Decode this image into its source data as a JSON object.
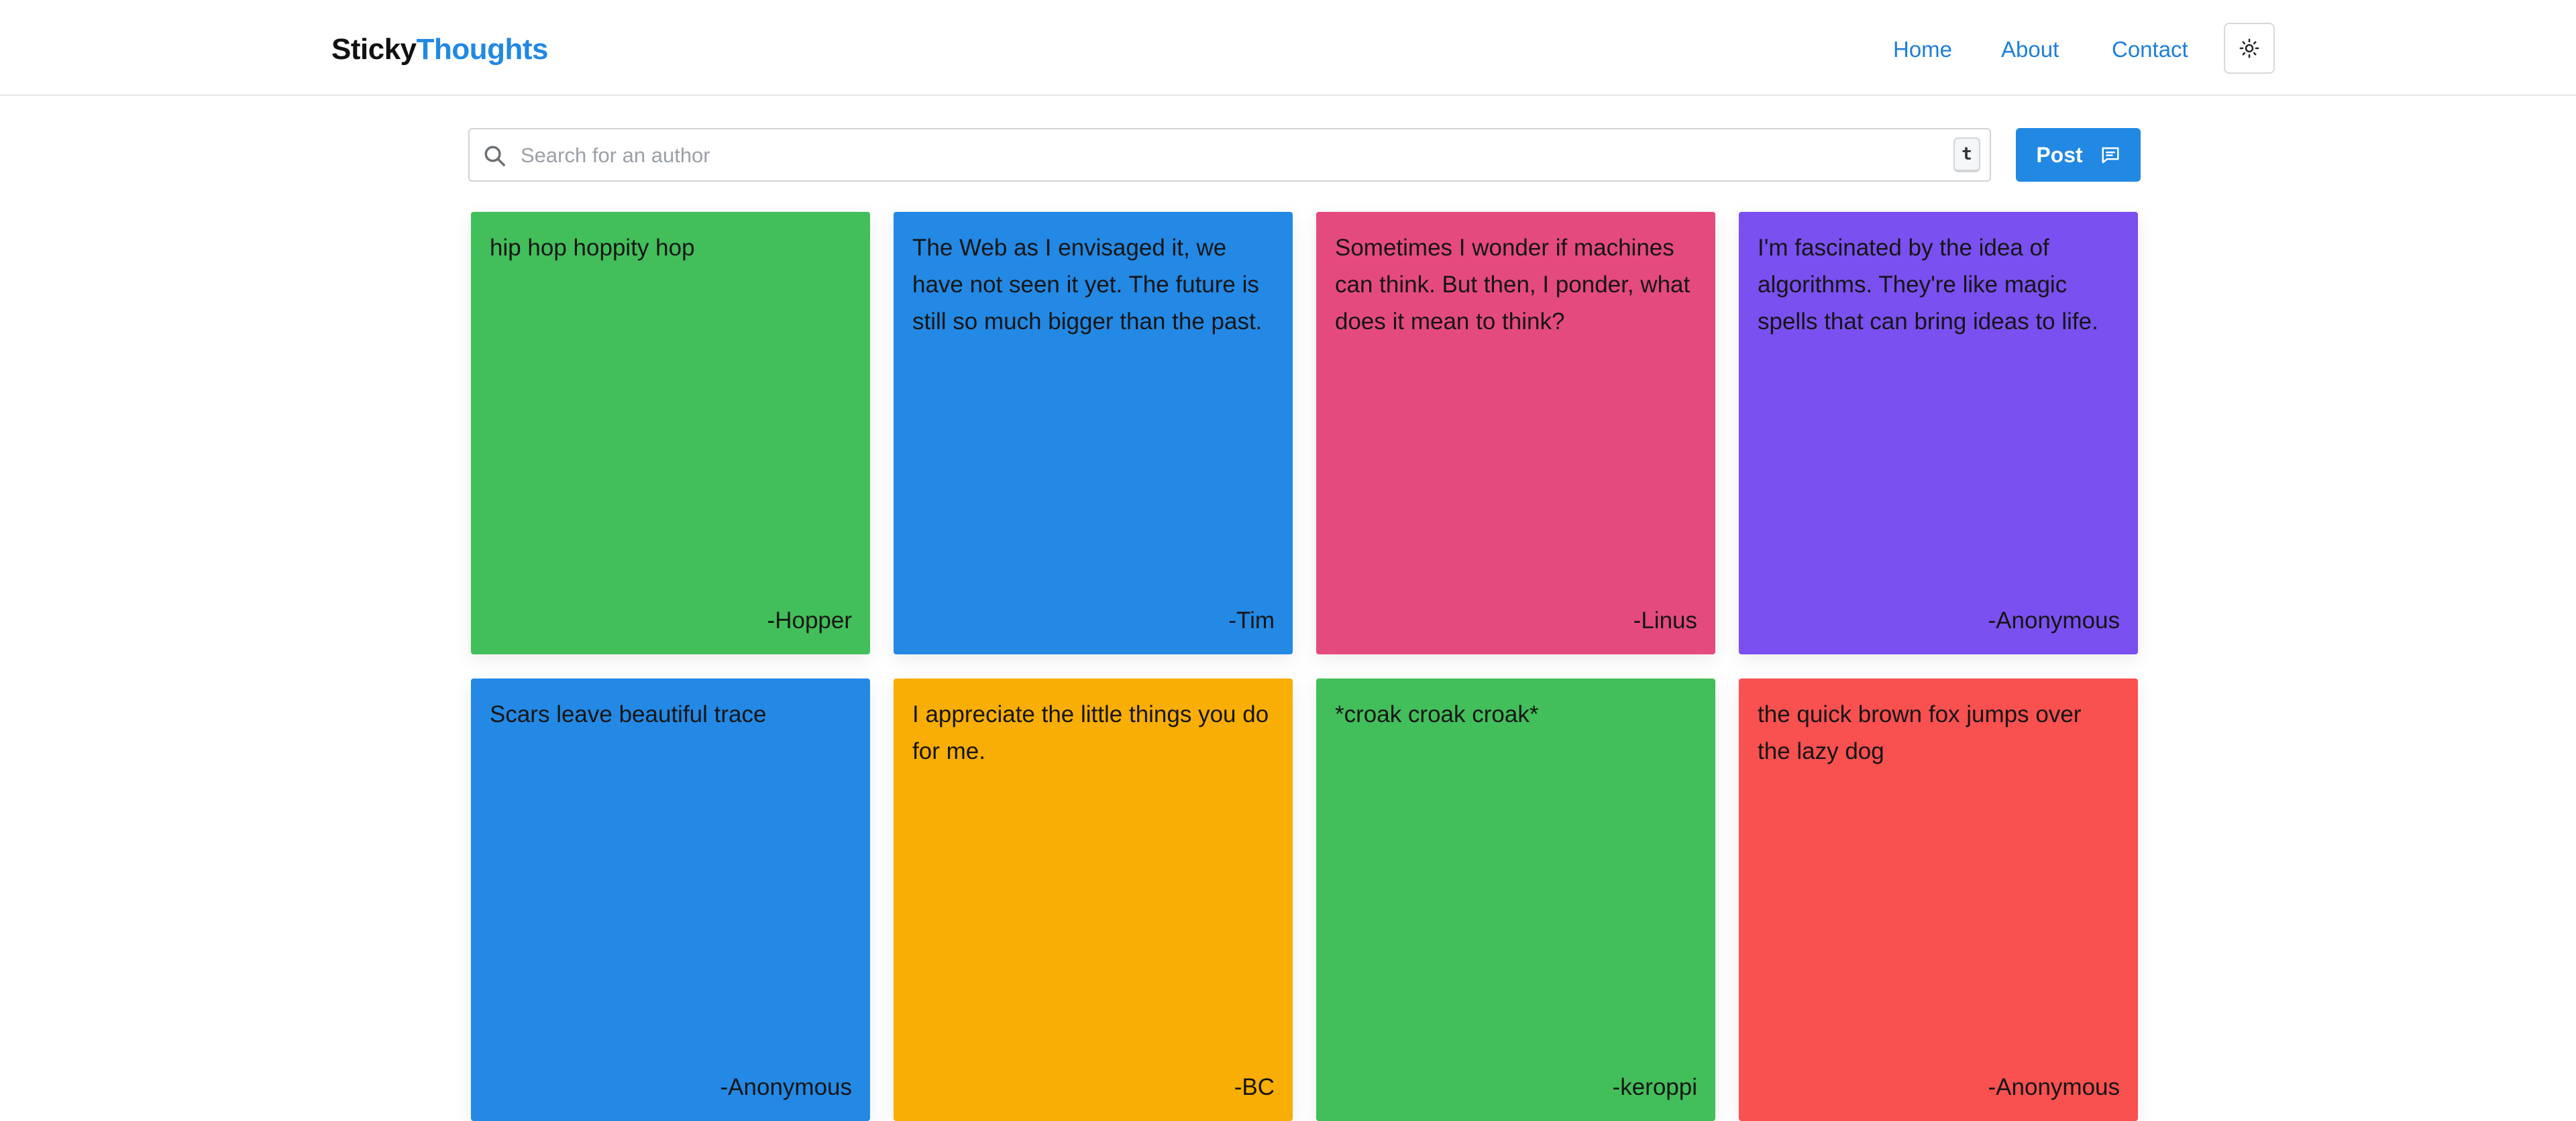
{
  "header": {
    "brand_part1": "Sticky",
    "brand_part2": "Thoughts",
    "nav": [
      "Home",
      "About",
      "Contact"
    ],
    "theme_toggle_icon": "sun-icon"
  },
  "toolbar": {
    "search_icon": "search-icon",
    "search_placeholder": "Search for an author",
    "search_value": "",
    "shortcut_key": "t",
    "post_label": "Post",
    "post_icon": "message-square-icon"
  },
  "colors": {
    "accent": "#2188e3",
    "green": "#42bf5a",
    "blue": "#2389e5",
    "pink": "#e54a7e",
    "purple": "#7a50f0",
    "amber": "#f9ae05",
    "red": "#f95050"
  },
  "notes": [
    {
      "text": "hip hop hoppity hop",
      "author": "-Hopper",
      "color": "#42bf5a"
    },
    {
      "text": "The Web as I envisaged it, we have not seen it yet. The future is still so much bigger than the past.",
      "author": "-Tim",
      "color": "#2389e5"
    },
    {
      "text": "Sometimes I wonder if machines can think. But then, I ponder, what does it mean to think?",
      "author": "-Linus",
      "color": "#e54a7e"
    },
    {
      "text": "I'm fascinated by the idea of algorithms. They're like magic spells that can bring ideas to life.",
      "author": "-Anonymous",
      "color": "#7a50f0"
    },
    {
      "text": "Scars leave beautiful trace",
      "author": "-Anonymous",
      "color": "#2389e5"
    },
    {
      "text": "I appreciate the little things you do for me.",
      "author": "-BC",
      "color": "#f9ae05"
    },
    {
      "text": "*croak croak croak*",
      "author": "-keroppi",
      "color": "#42bf5a"
    },
    {
      "text": "the quick brown fox jumps over the lazy dog",
      "author": "-Anonymous",
      "color": "#f95050"
    }
  ]
}
